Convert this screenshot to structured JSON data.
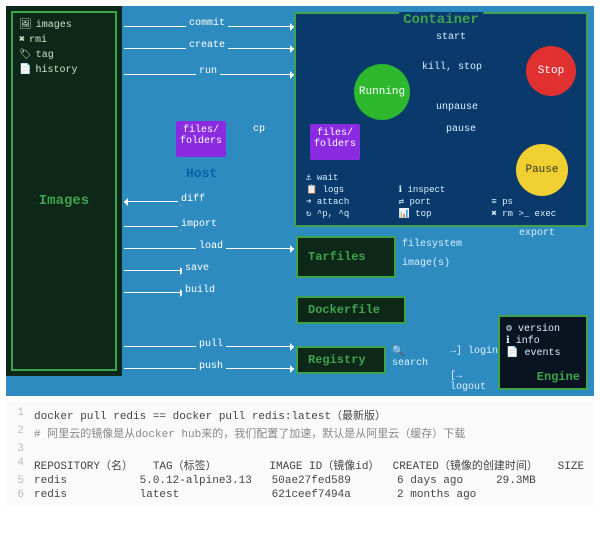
{
  "sidebar": {
    "items": [
      {
        "icon": "🖼",
        "label": "images"
      },
      {
        "icon": "✖",
        "label": "rmi"
      },
      {
        "icon": "🏷",
        "label": "tag"
      },
      {
        "icon": "📄",
        "label": "history"
      }
    ],
    "title": "Images"
  },
  "host": {
    "label": "Host",
    "filesfolders": "files/\nfolders"
  },
  "container": {
    "title": "Container",
    "states": {
      "running": "Running",
      "stop": "Stop",
      "pause": "Pause"
    },
    "filesfolders": "files/\nfolders",
    "edges": {
      "start": "start",
      "killstop": "kill, stop",
      "pause": "pause",
      "unpause": "unpause",
      "cp": "cp"
    },
    "commands": [
      "⚓ wait",
      "",
      "",
      "📋 logs",
      "ℹ inspect",
      "",
      "➜ attach",
      "⇄ port",
      "≡ ps",
      "↻ ^p, ^q",
      "📊 top",
      "✖ rm   >_ exec"
    ]
  },
  "arrows": {
    "commit": "commit",
    "create": "create",
    "run": "run",
    "diff": "diff",
    "import": "import",
    "load": "load",
    "save": "save",
    "build": "build",
    "pull": "pull",
    "push": "push",
    "export": "export"
  },
  "tarfiles": {
    "title": "Tarfiles",
    "sub1": "filesystem",
    "sub2": "image(s)"
  },
  "dockerfile": {
    "title": "Dockerfile"
  },
  "registry": {
    "title": "Registry",
    "cmds": [
      "🔍 search",
      "→] login",
      "",
      "[→ logout"
    ]
  },
  "engine": {
    "title": "Engine",
    "items": [
      "⚙ version",
      "ℹ info",
      "📄 events"
    ]
  },
  "code": {
    "lines": [
      {
        "n": "1",
        "t": "docker pull redis == docker pull redis:latest（最新版）"
      },
      {
        "n": "2",
        "t": "# 阿里云的镜像是从docker hub来的，我们配置了加速，默认是从阿里云（缓存）下载",
        "c": true
      },
      {
        "n": "3",
        "t": ""
      },
      {
        "n": "4",
        "t": "REPOSITORY（名）   TAG（标签）        IMAGE ID（镜像id）  CREATED（镜像的创建时间）   SIZE"
      },
      {
        "n": "5",
        "t": "redis           5.0.12-alpine3.13   50ae27fed589       6 days ago     29.3MB"
      },
      {
        "n": "6",
        "t": "redis           latest              621ceef7494a       2 months ago"
      }
    ]
  }
}
